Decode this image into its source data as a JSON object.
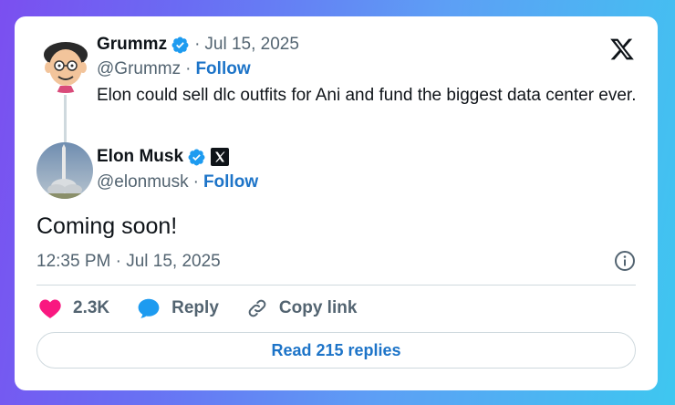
{
  "colors": {
    "accent": "#1d9bf0",
    "link": "#1d74c8",
    "heart": "#f91880",
    "muted": "#536471"
  },
  "quoted_tweet": {
    "author_name": "Grummz",
    "date": "Jul 15, 2025",
    "handle": "@Grummz",
    "follow_label": "Follow",
    "text": "Elon could sell dlc outfits for Ani and fund the biggest data center ever.",
    "avatar_icon": "cartoon-avatar-icon"
  },
  "main_tweet": {
    "author_name": "Elon Musk",
    "handle": "@elonmusk",
    "follow_label": "Follow",
    "text": "Coming soon!",
    "timestamp": "12:35 PM · Jul 15, 2025",
    "avatar_icon": "rocket-avatar-icon"
  },
  "actions": {
    "like_count": "2.3K",
    "reply_label": "Reply",
    "copy_link_label": "Copy link"
  },
  "read_replies_label": "Read 215 replies",
  "separator": "·"
}
